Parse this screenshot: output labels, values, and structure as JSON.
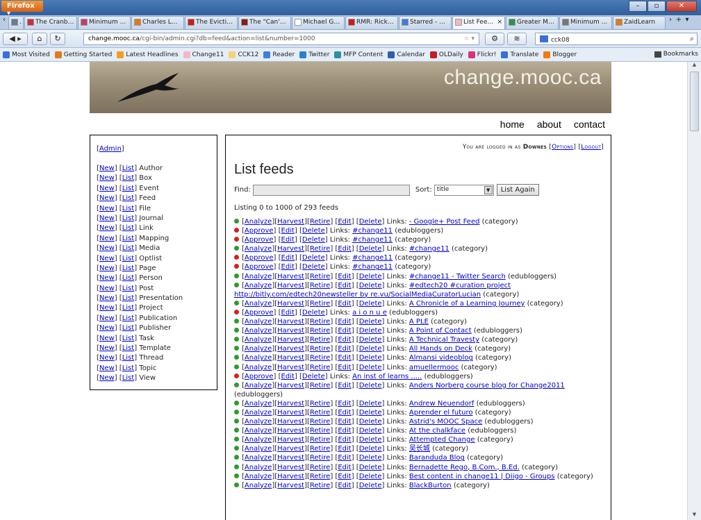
{
  "browser": {
    "app_button": "Firefox ▾",
    "tabs": [
      {
        "title": "...",
        "fav": "#6b7c94"
      },
      {
        "title": "The Cranbe...",
        "fav": "#c8323a"
      },
      {
        "title": "Minimum ...",
        "fav": "#c63d6b"
      },
      {
        "title": "Charles Lebl...",
        "fav": "#e07a18"
      },
      {
        "title": "The Evictio...",
        "fav": "#cc1b1b"
      },
      {
        "title": "The \"Can't ...",
        "fav": "#8a1c1c"
      },
      {
        "title": "Michael Gei...",
        "fav": "#ffffff"
      },
      {
        "title": "RMR: Rick's ...",
        "fav": "#cc1b1b"
      },
      {
        "title": "Starred - Go...",
        "fav": "#3d7fd6"
      },
      {
        "title": "List Feed...",
        "fav": "#f2b7c9",
        "active": true
      },
      {
        "title": "Greater Mo...",
        "fav": "#2f8f4f"
      },
      {
        "title": "Minimum ...",
        "fav": "#777777"
      },
      {
        "title": "ZaidLearn",
        "fav": "#e07a18"
      }
    ],
    "url_host": "change.mooc.ca",
    "url_path": "/cgi-bin/admin.cgi?db=feed&action=list&number=1000",
    "search_value": "cck08",
    "bookmarks": [
      {
        "label": "Most Visited",
        "fav": "#3b6fd8"
      },
      {
        "label": "Getting Started",
        "fav": "#e07a18"
      },
      {
        "label": "Latest Headlines",
        "fav": "#f0a020"
      },
      {
        "label": "Change11",
        "fav": "#f2b7c9"
      },
      {
        "label": "CCK12",
        "fav": "#f4d27a"
      },
      {
        "label": "Reader",
        "fav": "#3d7fd6"
      },
      {
        "label": "Twitter",
        "fav": "#2b7fd0"
      },
      {
        "label": "MFP Content",
        "fav": "#2f8fa0"
      },
      {
        "label": "Calendar",
        "fav": "#2b5fb0"
      },
      {
        "label": "OLDaily",
        "fav": "#c0202a"
      },
      {
        "label": "Flickr!",
        "fav": "#e0307a"
      },
      {
        "label": "Translate",
        "fav": "#3b6fd8"
      },
      {
        "label": "Blogger",
        "fav": "#f07a10"
      }
    ],
    "bookmarks_menu": "Bookmarks"
  },
  "site": {
    "title": "change.mooc.ca",
    "nav": [
      "home",
      "about",
      "contact"
    ]
  },
  "sidebar": {
    "admin": "Admin",
    "new_label": "New",
    "list_label": "List",
    "items": [
      "Author",
      "Box",
      "Event",
      "Feed",
      "File",
      "Journal",
      "Link",
      "Mapping",
      "Media",
      "Optlist",
      "Page",
      "Person",
      "Post",
      "Presentation",
      "Project",
      "Publication",
      "Publisher",
      "Task",
      "Template",
      "Thread",
      "Topic",
      "View"
    ]
  },
  "main": {
    "logged_prefix": "You are logged in as",
    "user": "Downes",
    "options": "Options",
    "logout": "Logout",
    "title": "List feeds",
    "find_label": "Find:",
    "sort_label": "Sort:",
    "sort_value": "title",
    "list_again": "List Again",
    "listing": "Listing 0 to 1000 of 293 feeds",
    "links_label": "Links:",
    "feeds": [
      {
        "status": "green",
        "title": "- Google+ Post Feed",
        "type": "category"
      },
      {
        "status": "red",
        "title": "#change11",
        "type": "edubloggers"
      },
      {
        "status": "red",
        "title": "#change11",
        "type": "category"
      },
      {
        "status": "green",
        "title": "#change11",
        "type": "category"
      },
      {
        "status": "red",
        "title": "#change11",
        "type": "category"
      },
      {
        "status": "red",
        "title": "#change11",
        "type": "category"
      },
      {
        "status": "green",
        "title": "#change11 - Twitter Search",
        "type": "edubloggers"
      },
      {
        "status": "green",
        "title": "#edtech20 #curation project http://bitly.com/edtech20newsteller by re.vu/SocialMediaCuratorLucian",
        "type": "category",
        "wrap": true
      },
      {
        "status": "green",
        "title": "A Chronicle of a Learning Journey",
        "type": "category"
      },
      {
        "status": "red",
        "title": "a i o n u e",
        "type": "edubloggers"
      },
      {
        "status": "green",
        "title": "A PLE",
        "type": "category"
      },
      {
        "status": "green",
        "title": "A Point of Contact",
        "type": "edubloggers"
      },
      {
        "status": "green",
        "title": "A Technical Travesty",
        "type": "category"
      },
      {
        "status": "green",
        "title": "All Hands on Deck",
        "type": "category"
      },
      {
        "status": "green",
        "title": "Almansi videoblog",
        "type": "category"
      },
      {
        "status": "green",
        "title": "amuellermooc",
        "type": "category"
      },
      {
        "status": "red",
        "title": "An inst of learns .....",
        "type": "edubloggers"
      },
      {
        "status": "green",
        "title": "Anders Norberg course blog for Change2011",
        "type": "edubloggers",
        "wrap": true
      },
      {
        "status": "green",
        "title": "Andrew Neuendorf",
        "type": "edubloggers"
      },
      {
        "status": "green",
        "title": "Aprender el futuro",
        "type": "category"
      },
      {
        "status": "green",
        "title": "Astrid's MOOC Space",
        "type": "edubloggers"
      },
      {
        "status": "green",
        "title": "At the chalkface",
        "type": "edubloggers"
      },
      {
        "status": "green",
        "title": "Attempted Change",
        "type": "category"
      },
      {
        "status": "green",
        "title": "吴长城",
        "type": "category"
      },
      {
        "status": "green",
        "title": "Baranduda Blog",
        "type": "category"
      },
      {
        "status": "green",
        "title": "Bernadette Rego, B.Com., B.Ed.",
        "type": "category"
      },
      {
        "status": "green",
        "title": "Best content in change11 | Diigo - Groups",
        "type": "category"
      },
      {
        "status": "green",
        "title": "BlackBurton",
        "type": "category"
      }
    ],
    "actions_green": [
      "Analyze",
      "Harvest",
      "Retire",
      "Edit",
      "Delete"
    ],
    "actions_red": [
      "Approve",
      "Edit",
      "Delete"
    ]
  }
}
